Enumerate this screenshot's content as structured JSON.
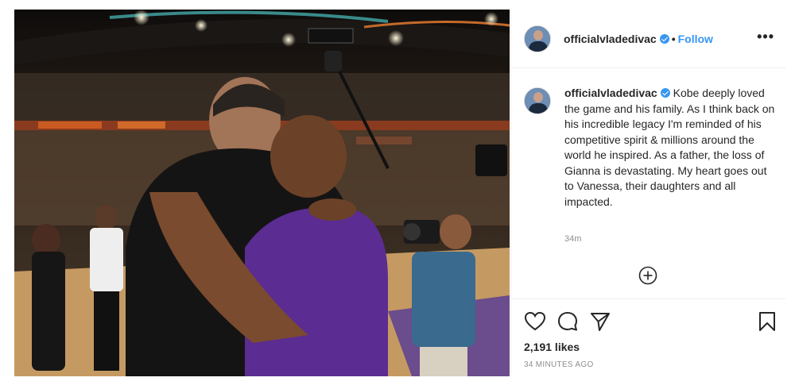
{
  "post": {
    "username": "officialvladedivac",
    "follow_label": "Follow",
    "separator": "•",
    "more_label": "•••",
    "caption": "Kobe deeply loved the game and his family. As I think back on his incredible legacy I'm reminded of his competitive spirit & millions around the world he inspired. As a father, the loss of Gianna is devastating. My heart goes out to Vanessa, their daughters and all impacted.",
    "caption_time": "34m",
    "likes": "2,191 likes",
    "posted_ago": "34 MINUTES AGO"
  },
  "icons": {
    "verified": "verified-badge-icon",
    "more": "more-options-icon",
    "load_more": "plus-circle-icon",
    "like": "heart-icon",
    "comment": "comment-icon",
    "share": "paper-plane-icon",
    "save": "bookmark-icon"
  },
  "colors": {
    "link_blue": "#3897f0",
    "verified_blue": "#3897f0",
    "muted_text": "#8e8e8e",
    "text": "#262626",
    "jersey_purple": "#5b2c91"
  }
}
